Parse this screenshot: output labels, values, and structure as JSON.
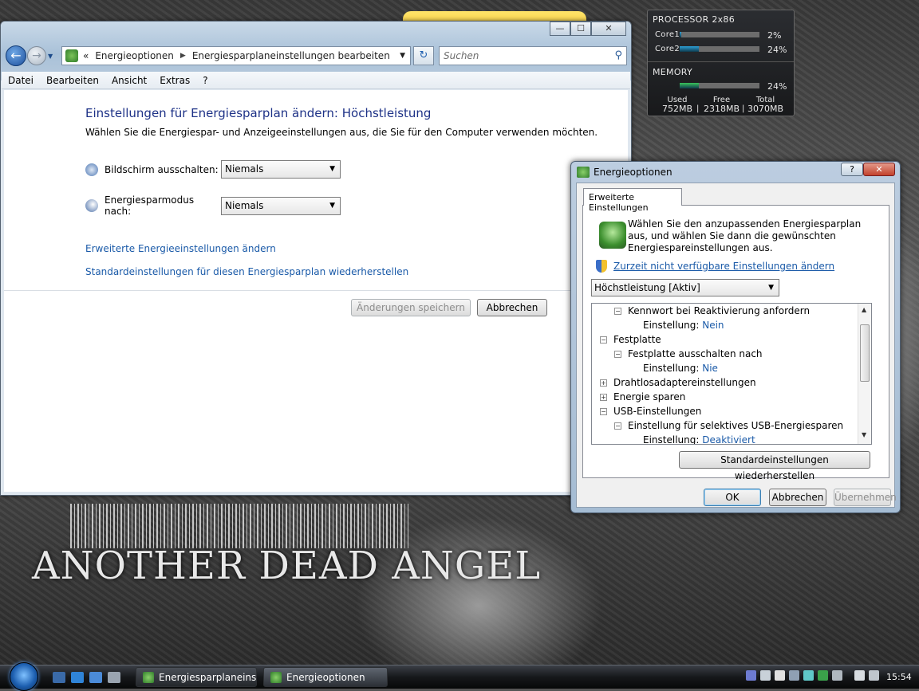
{
  "explorer": {
    "breadcrumb": [
      "Energieoptionen",
      "Energiesparplaneinstellungen bearbeiten"
    ],
    "search_placeholder": "Suchen",
    "menu": [
      "Datei",
      "Bearbeiten",
      "Ansicht",
      "Extras",
      "?"
    ],
    "heading": "Einstellungen für Energiesparplan ändern: Höchstleistung",
    "subheading": "Wählen Sie die Energiespar- und Anzeigeeinstellungen aus, die Sie für den Computer verwenden möchten.",
    "display_off_label": "Bildschirm ausschalten:",
    "display_off_value": "Niemals",
    "sleep_label": "Energiesparmodus nach:",
    "sleep_value": "Niemals",
    "link_advanced": "Erweiterte Energieeinstellungen ändern",
    "link_restore": "Standardeinstellungen für diesen Energiesparplan wiederherstellen",
    "save_button": "Änderungen speichern",
    "cancel_button": "Abbrechen",
    "caption": {
      "minimize": "—",
      "maximize": "☐",
      "close": "✕"
    }
  },
  "gadget": {
    "processor_title": "PROCESSOR 2x86",
    "core1_label": "Core1",
    "core1_pct": "2%",
    "core1_level": 2,
    "core2_label": "Core2",
    "core2_pct": "24%",
    "core2_level": 24,
    "memory_title": "MEMORY",
    "memory_pct": "24%",
    "memory_level": 24,
    "used_label": "Used",
    "used_value": "752MB",
    "free_label": "Free",
    "free_value": "2318MB",
    "total_label": "Total",
    "total_value": "3070MB",
    "separator": "|"
  },
  "dialog": {
    "title": "Energieoptionen",
    "help": "?",
    "close": "✕",
    "tab": "Erweiterte Einstellungen",
    "prompt": "Wählen Sie den anzupassenden Energiesparplan aus, und wählen Sie dann die gewünschten Energiespareinstellungen aus.",
    "uac_link": "Zurzeit nicht verfügbare Einstellungen ändern",
    "plan": "Höchstleistung [Aktiv]",
    "tree": {
      "i0": "Kennwort bei Reaktivierung anfordern",
      "i1_label": "Einstellung:",
      "i1_value": "Nein",
      "i2": "Festplatte",
      "i3": "Festplatte ausschalten nach",
      "i4_label": "Einstellung:",
      "i4_value": "Nie",
      "i5": "Drahtlosadaptereinstellungen",
      "i6": "Energie sparen",
      "i7": "USB-Einstellungen",
      "i8": "Einstellung für selektives USB-Energiesparen",
      "i9_label": "Einstellung:",
      "i9_value": "Deaktiviert"
    },
    "restore_button": "Standardeinstellungen wiederherstellen",
    "ok_button": "OK",
    "cancel_button": "Abbrechen",
    "apply_button": "Übernehmen"
  },
  "wallpaper_text": "ANOTHER DEAD ANGEL",
  "taskbar": {
    "task1": "Energiesparplaneins...",
    "task2": "Energieoptionen",
    "clock": "15:54"
  },
  "colors": {
    "accent_link": "#1a5aa8",
    "heading": "#1e3287",
    "core_bar": "#2c9fd6",
    "memory_bar": "#39c25a"
  }
}
